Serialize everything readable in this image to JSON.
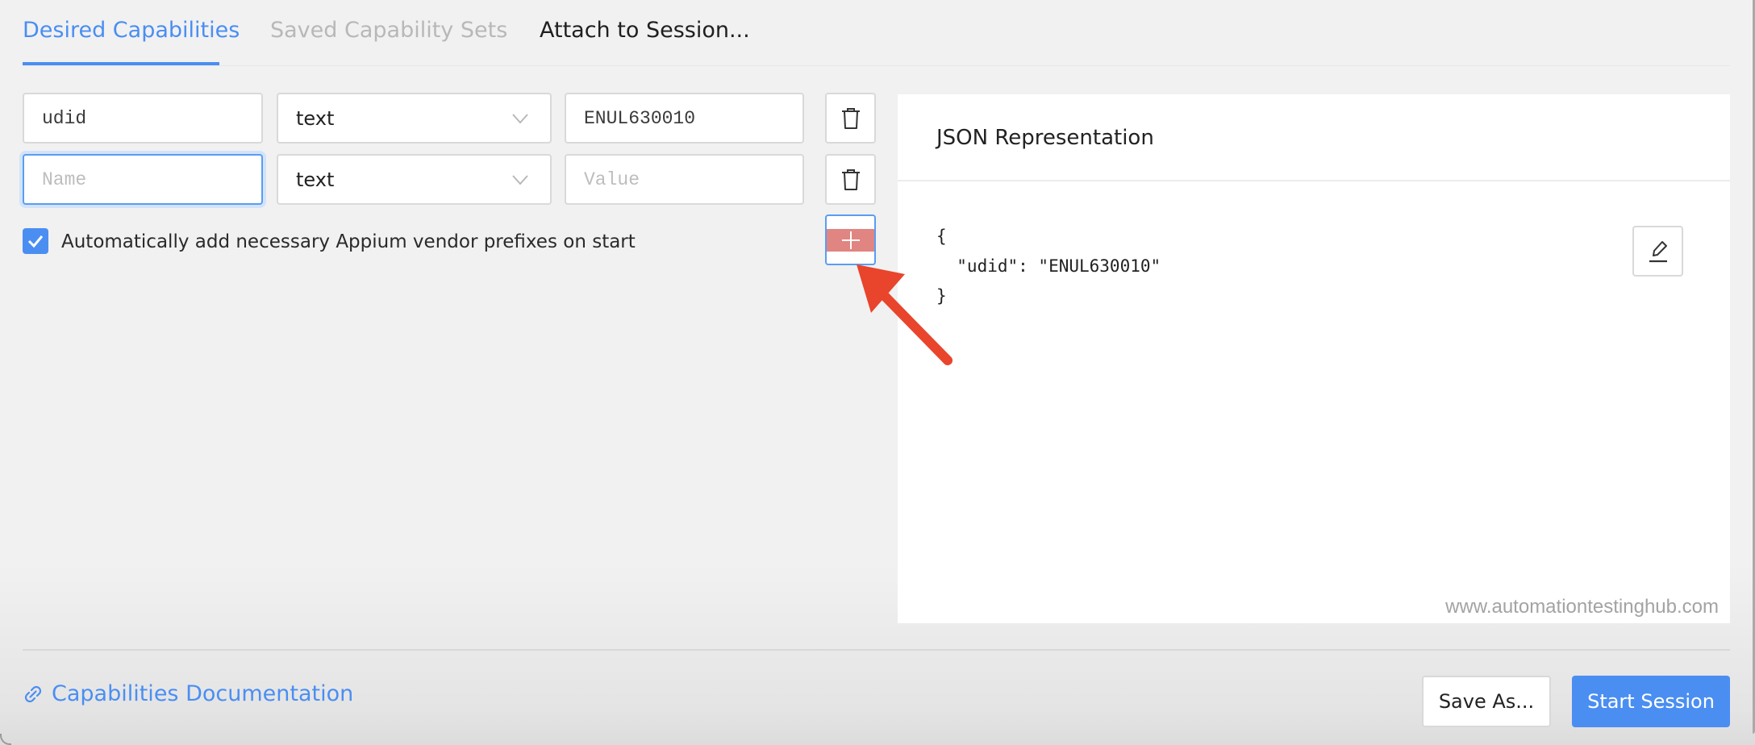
{
  "tabs": [
    {
      "label": "Desired Capabilities",
      "state": "active"
    },
    {
      "label": "Saved Capability Sets",
      "state": "disabled"
    },
    {
      "label": "Attach to Session...",
      "state": "normal"
    }
  ],
  "capabilities": [
    {
      "name": "udid",
      "name_placeholder": "Name",
      "type": "text",
      "value": "ENUL630010",
      "value_placeholder": "Value"
    },
    {
      "name": "",
      "name_placeholder": "Name",
      "type": "text",
      "value": "",
      "value_placeholder": "Value"
    }
  ],
  "icons": {
    "delete": "trash-icon",
    "add": "plus-icon",
    "edit": "pencil-icon",
    "link": "link-icon",
    "chevron": "chevron-down-icon",
    "check": "checkmark-icon"
  },
  "vendor_prefix_checkbox": {
    "checked": true,
    "label": "Automatically add necessary Appium vendor prefixes on start"
  },
  "json_panel": {
    "title": "JSON Representation",
    "code": "{\n  \"udid\": \"ENUL630010\"\n}",
    "watermark": "www.automationtestinghub.com"
  },
  "footer": {
    "docs_link": "Capabilities Documentation",
    "save_as": "Save As...",
    "start_session": "Start Session"
  },
  "colors": {
    "accent": "#4a8ef2",
    "annotation_arrow": "#e8452c",
    "add_button_highlight": "#e08582"
  }
}
